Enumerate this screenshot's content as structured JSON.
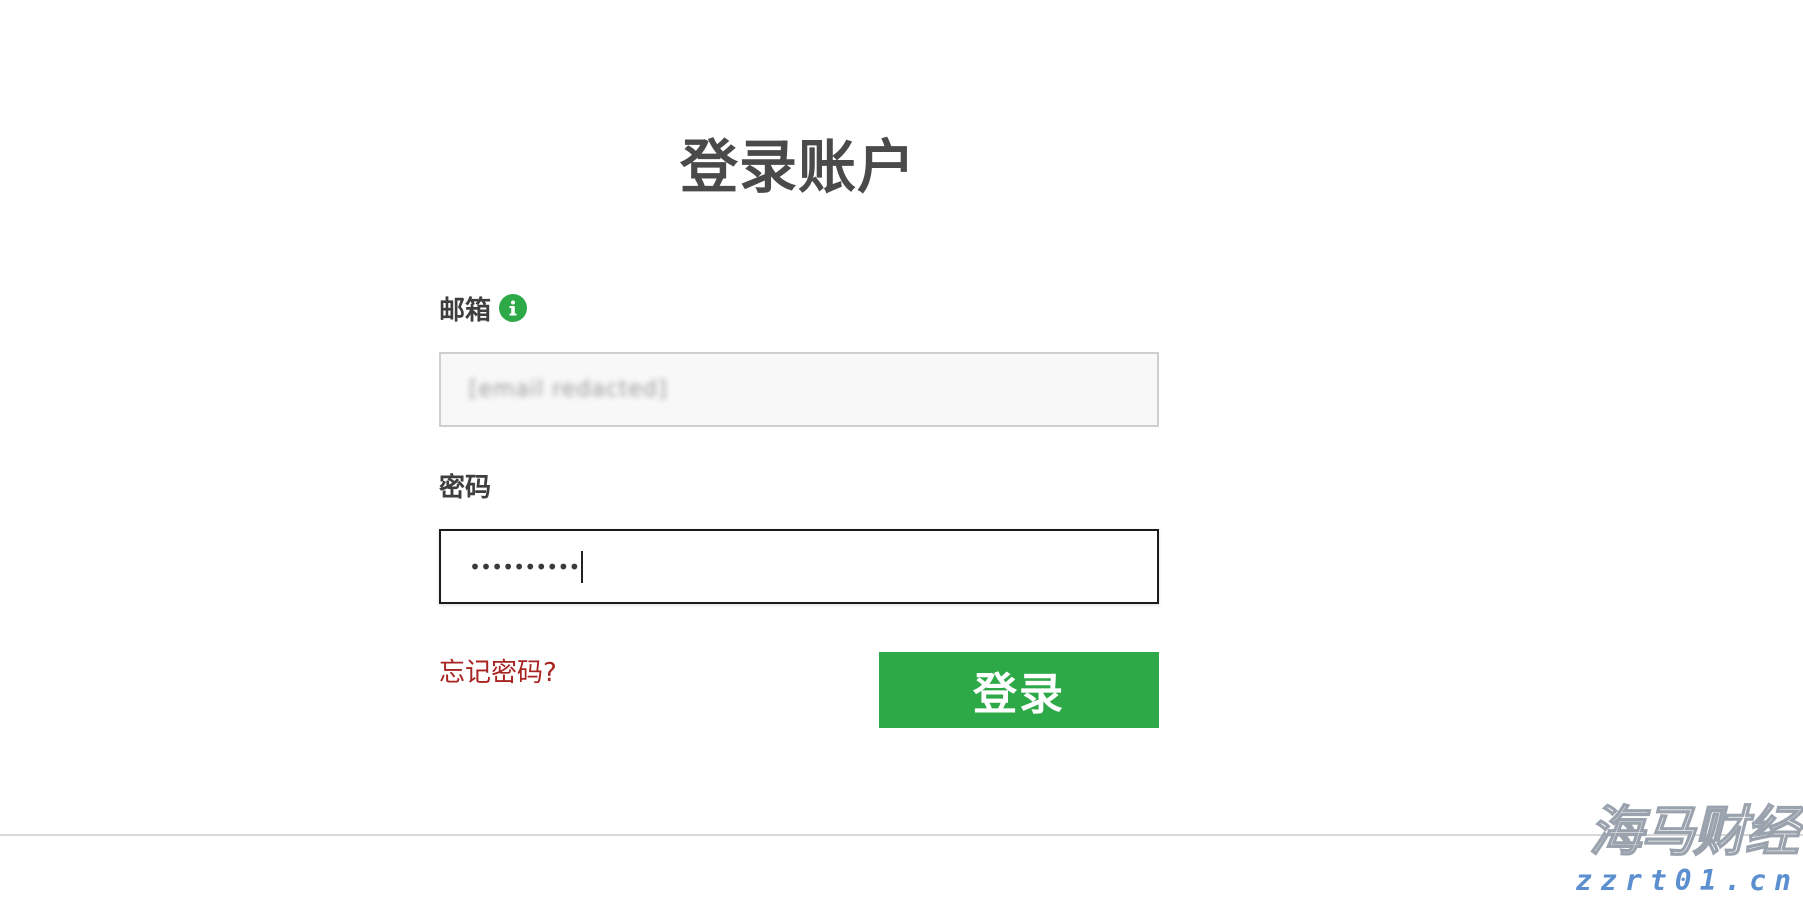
{
  "page": {
    "title": "登录账户"
  },
  "email": {
    "label": "邮箱",
    "info_icon": "info-icon",
    "value": "[email redacted]"
  },
  "password": {
    "label": "密码",
    "value": "••••••••••"
  },
  "actions": {
    "forgot_label": "忘记密码?",
    "login_label": "登录"
  },
  "watermark": {
    "name": "海马财经",
    "url": "zzrt01.cn"
  },
  "colors": {
    "accent_green": "#2ea948",
    "link_red": "#a82421",
    "title_gray": "#4a4a4a"
  }
}
